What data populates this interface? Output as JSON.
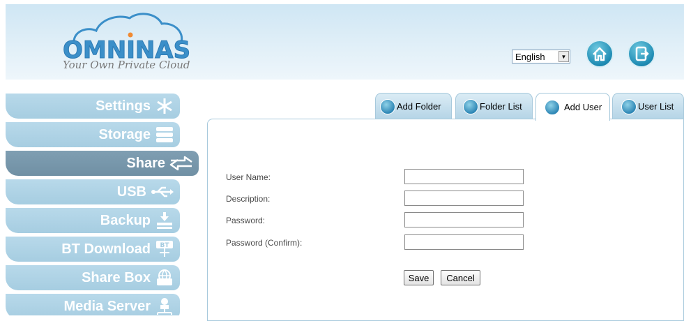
{
  "header": {
    "logo_title": "OMNINAS",
    "logo_tagline": "Your Own Private Cloud",
    "language": "English"
  },
  "sidebar": {
    "items": [
      {
        "label": "Settings",
        "icon": "snowflake-icon"
      },
      {
        "label": "Storage",
        "icon": "disk-stack-icon"
      },
      {
        "label": "Share",
        "icon": "share-arrows-icon"
      },
      {
        "label": "USB",
        "icon": "usb-icon"
      },
      {
        "label": "Backup",
        "icon": "download-tray-icon"
      },
      {
        "label": "BT Download",
        "icon": "bt-icon"
      },
      {
        "label": "Share Box",
        "icon": "globe-folder-icon"
      },
      {
        "label": "Media Server",
        "icon": "media-network-icon"
      }
    ],
    "active": "Share"
  },
  "tabs": [
    {
      "label": "Add Folder",
      "icon": "add-folder-icon"
    },
    {
      "label": "Folder List",
      "icon": "folder-list-icon"
    },
    {
      "label": "Add User",
      "icon": "add-user-icon"
    },
    {
      "label": "User List",
      "icon": "user-list-icon"
    }
  ],
  "active_tab": "Add User",
  "form": {
    "user_name_label": "User Name:",
    "description_label": "Description:",
    "password_label": "Password:",
    "password_confirm_label": "Password (Confirm):",
    "user_name_value": "",
    "description_value": "",
    "password_value": "",
    "password_confirm_value": "",
    "save_label": "Save",
    "cancel_label": "Cancel"
  },
  "colors": {
    "accent": "#3b8fc9",
    "nav_item": "#a6cde1",
    "nav_active": "#7090a4",
    "header_bg": "#cfe6f4"
  }
}
